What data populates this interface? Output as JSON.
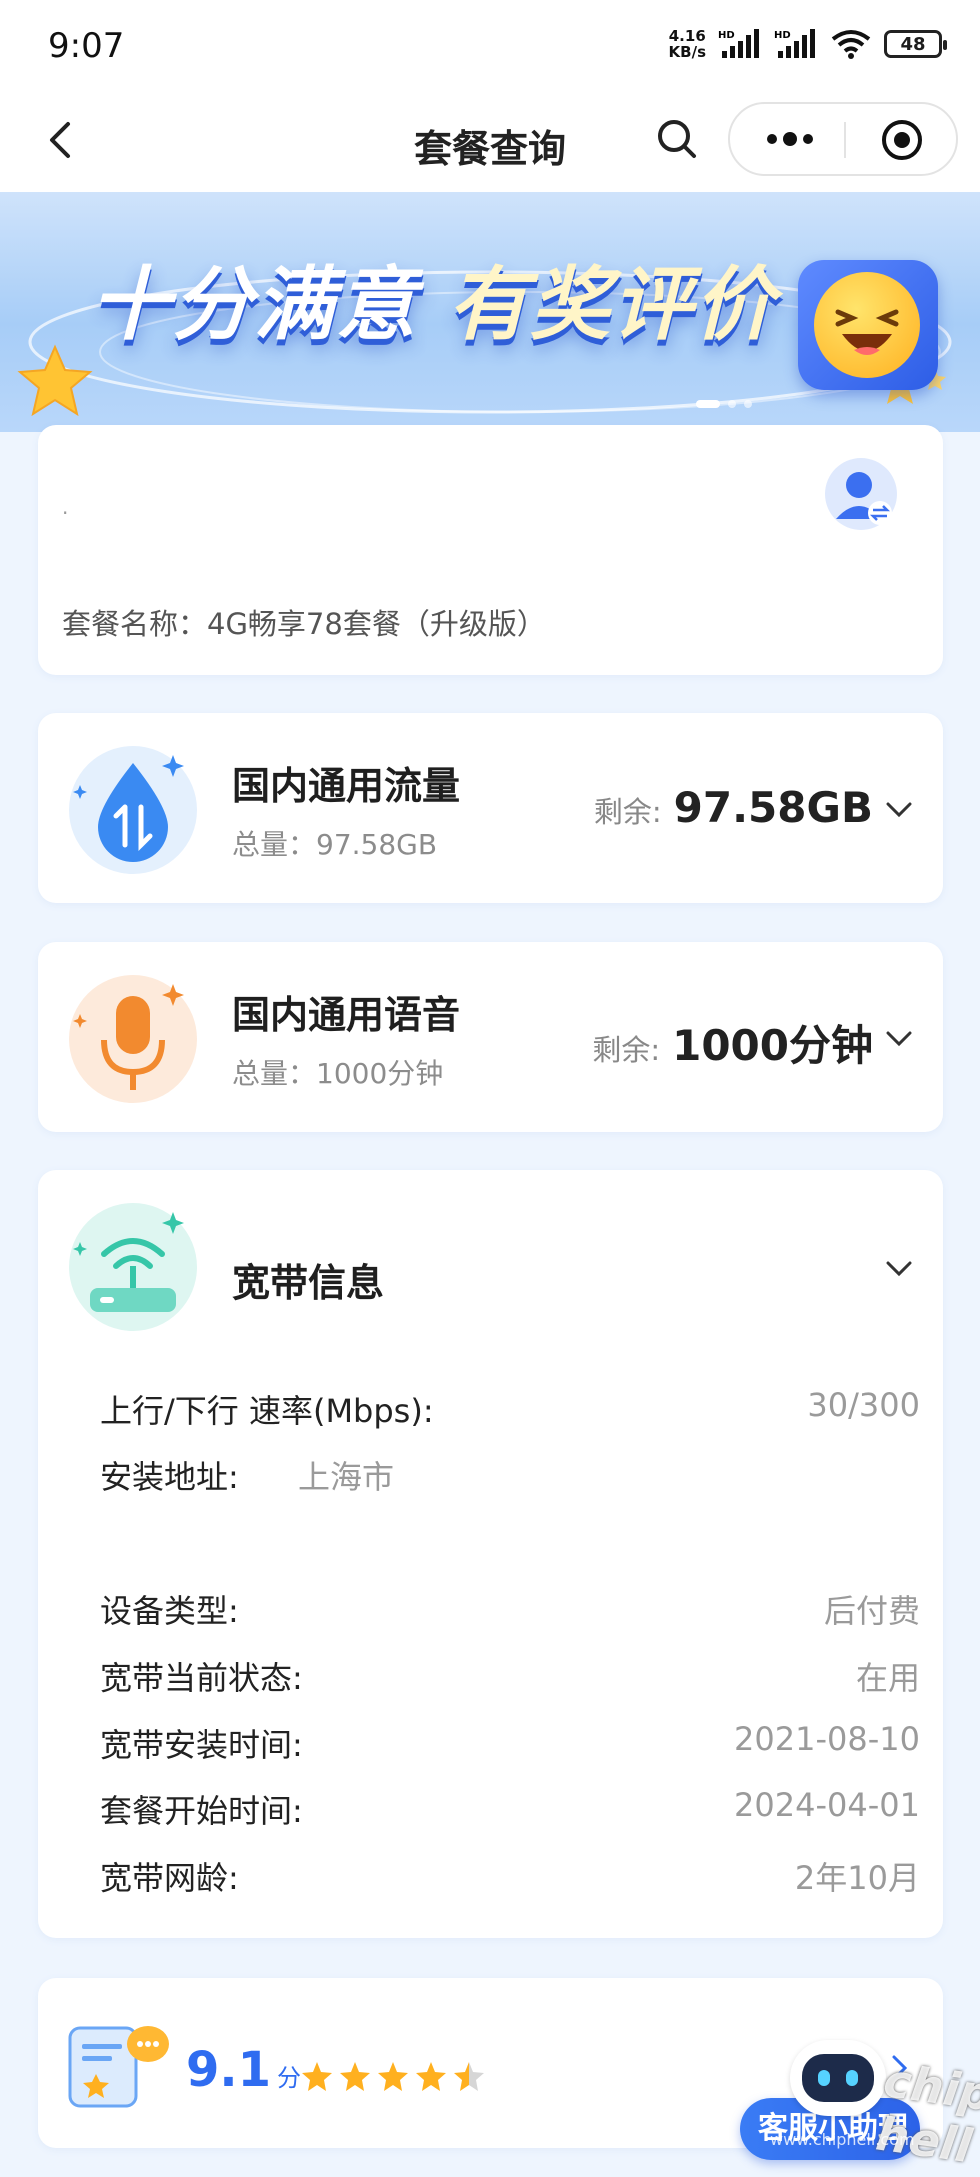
{
  "status_bar": {
    "time": "9:07",
    "net_speed_value": "4.16",
    "net_speed_unit": "KB/s",
    "hd1": "HD",
    "hd2": "HD",
    "battery": "48",
    "icons": [
      "signal-icon",
      "signal-icon",
      "wifi-icon",
      "battery-icon"
    ]
  },
  "nav": {
    "title": "套餐查询",
    "icons": [
      "back-icon",
      "search-icon",
      "more-icon",
      "target-icon"
    ]
  },
  "banner": {
    "text_part1": "十分满意",
    "text_part2": "有奖评价",
    "slides_total": 3,
    "active_slide": 1
  },
  "user_card": {
    "account_mark": ".",
    "plan_name": "套餐名称：4G畅享78套餐（升级版）",
    "icon": "switch-user-icon"
  },
  "data_card": {
    "title": "国内通用流量",
    "total": "总量：97.58GB",
    "remain_label": "剩余:",
    "remain_value": "97.58GB",
    "icon": "data-drop-icon"
  },
  "voice_card": {
    "title": "国内通用语音",
    "total": "总量：1000分钟",
    "remain_label": "剩余:",
    "remain_value": "1000分钟",
    "icon": "microphone-icon"
  },
  "broadband": {
    "title": "宽带信息",
    "icon": "router-icon",
    "rows": [
      {
        "label": "上行/下行 速率(Mbps):",
        "value": "30/300"
      },
      {
        "label": "安装地址:",
        "value": "上海市"
      },
      {
        "label": "设备类型:",
        "value": "后付费"
      },
      {
        "label": "宽带当前状态:",
        "value": "在用"
      },
      {
        "label": "宽带安装时间:",
        "value": "2021-08-10"
      },
      {
        "label": "套餐开始时间:",
        "value": "2024-04-01"
      },
      {
        "label": "宽带网龄:",
        "value": "2年10月"
      }
    ]
  },
  "rating": {
    "score": "9.1",
    "unit": "分",
    "stars": 4.5,
    "link": "去",
    "icon": "rating-clipboard-icon"
  },
  "helper": {
    "label": "客服小助理"
  },
  "watermark": {
    "text": "chip hell",
    "url": "www.chiphell.com"
  },
  "colors": {
    "accent": "#2f6cf0",
    "background": "#eef5fe"
  }
}
